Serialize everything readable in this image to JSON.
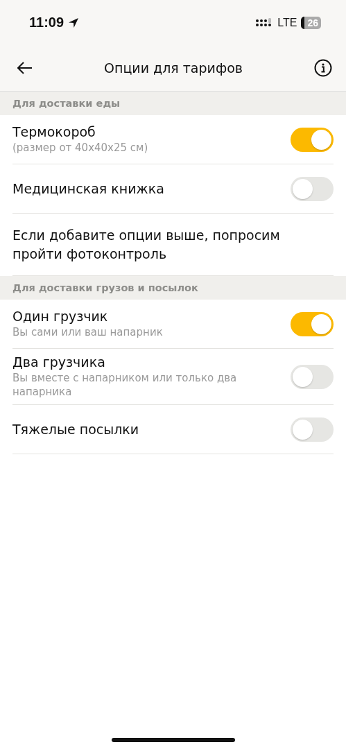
{
  "status_bar": {
    "time": "11:09",
    "network": "LTE",
    "battery": "26"
  },
  "header": {
    "title": "Опции для тарифов"
  },
  "sections": [
    {
      "title": "Для доставки еды",
      "items": [
        {
          "kind": "toggle",
          "label": "Термокороб",
          "subtitle": "(размер от 40x40x25 см)",
          "on": true
        },
        {
          "kind": "toggle",
          "label": "Медицинская книжка",
          "on": false
        },
        {
          "kind": "note",
          "label": "Если добавите опции выше, попросим пройти фотоконтроль"
        }
      ]
    },
    {
      "title": "Для доставки грузов и посылок",
      "items": [
        {
          "kind": "toggle",
          "label": "Один грузчик",
          "subtitle": "Вы сами или ваш напарник",
          "on": true
        },
        {
          "kind": "toggle",
          "label": "Два грузчика",
          "subtitle": "Вы вместе с напарником или только два напарника",
          "on": false
        },
        {
          "kind": "toggle",
          "label": "Тяжелые посылки",
          "on": false
        }
      ]
    }
  ]
}
